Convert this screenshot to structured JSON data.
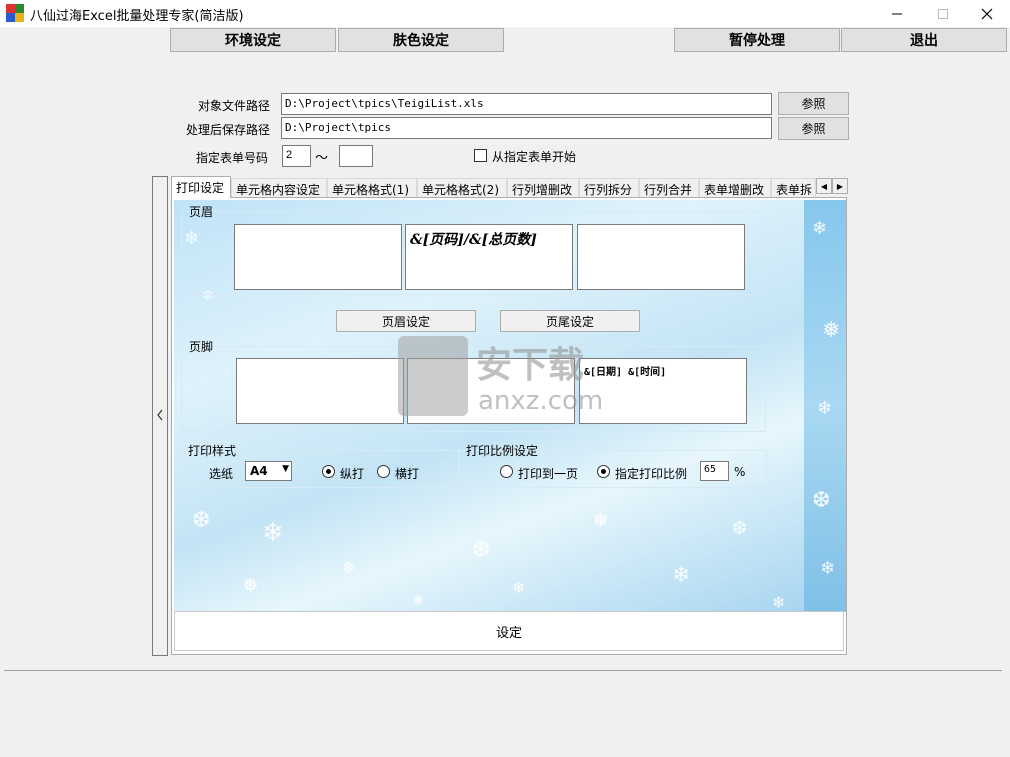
{
  "title": "八仙过海Excel批量处理专家(简洁版)",
  "toolbar": {
    "env": "环境设定",
    "skin": "肤色设定",
    "pause": "暂停处理",
    "exit": "退出"
  },
  "paths": {
    "target_label": "对象文件路径",
    "target_value": "D:\\Project\\tpics\\TeigiList.xls",
    "save_label": "处理后保存路径",
    "save_value": "D:\\Project\\tpics",
    "browse": "参照"
  },
  "sheet": {
    "label": "指定表单号码",
    "from": "2",
    "tilde": "～",
    "to": "",
    "start_from_label": "从指定表单开始"
  },
  "tabs": [
    "打印设定",
    "单元格内容设定",
    "单元格格式(1)",
    "单元格格式(2)",
    "行列增删改",
    "行列拆分",
    "行列合并",
    "表单增删改",
    "表单拆"
  ],
  "header": {
    "group_label": "页眉",
    "left": "",
    "center": "&[页码]/&[总页数]",
    "right": "",
    "header_btn": "页眉设定",
    "footer_btn": "页尾设定"
  },
  "footer": {
    "group_label": "页脚",
    "left": "",
    "center": "",
    "right": "&[日期] &[时间]"
  },
  "print_style": {
    "group_label": "打印样式",
    "paper_label": "选纸",
    "paper_value": "A4",
    "portrait": "纵打",
    "landscape": "横打"
  },
  "print_scale": {
    "group_label": "打印比例设定",
    "fit_one_page": "打印到一页",
    "specify": "指定打印比例",
    "value": "65",
    "unit": "%"
  },
  "watermark": {
    "text": "安下载",
    "sub": "anxz.com"
  },
  "apply_button": "设定"
}
